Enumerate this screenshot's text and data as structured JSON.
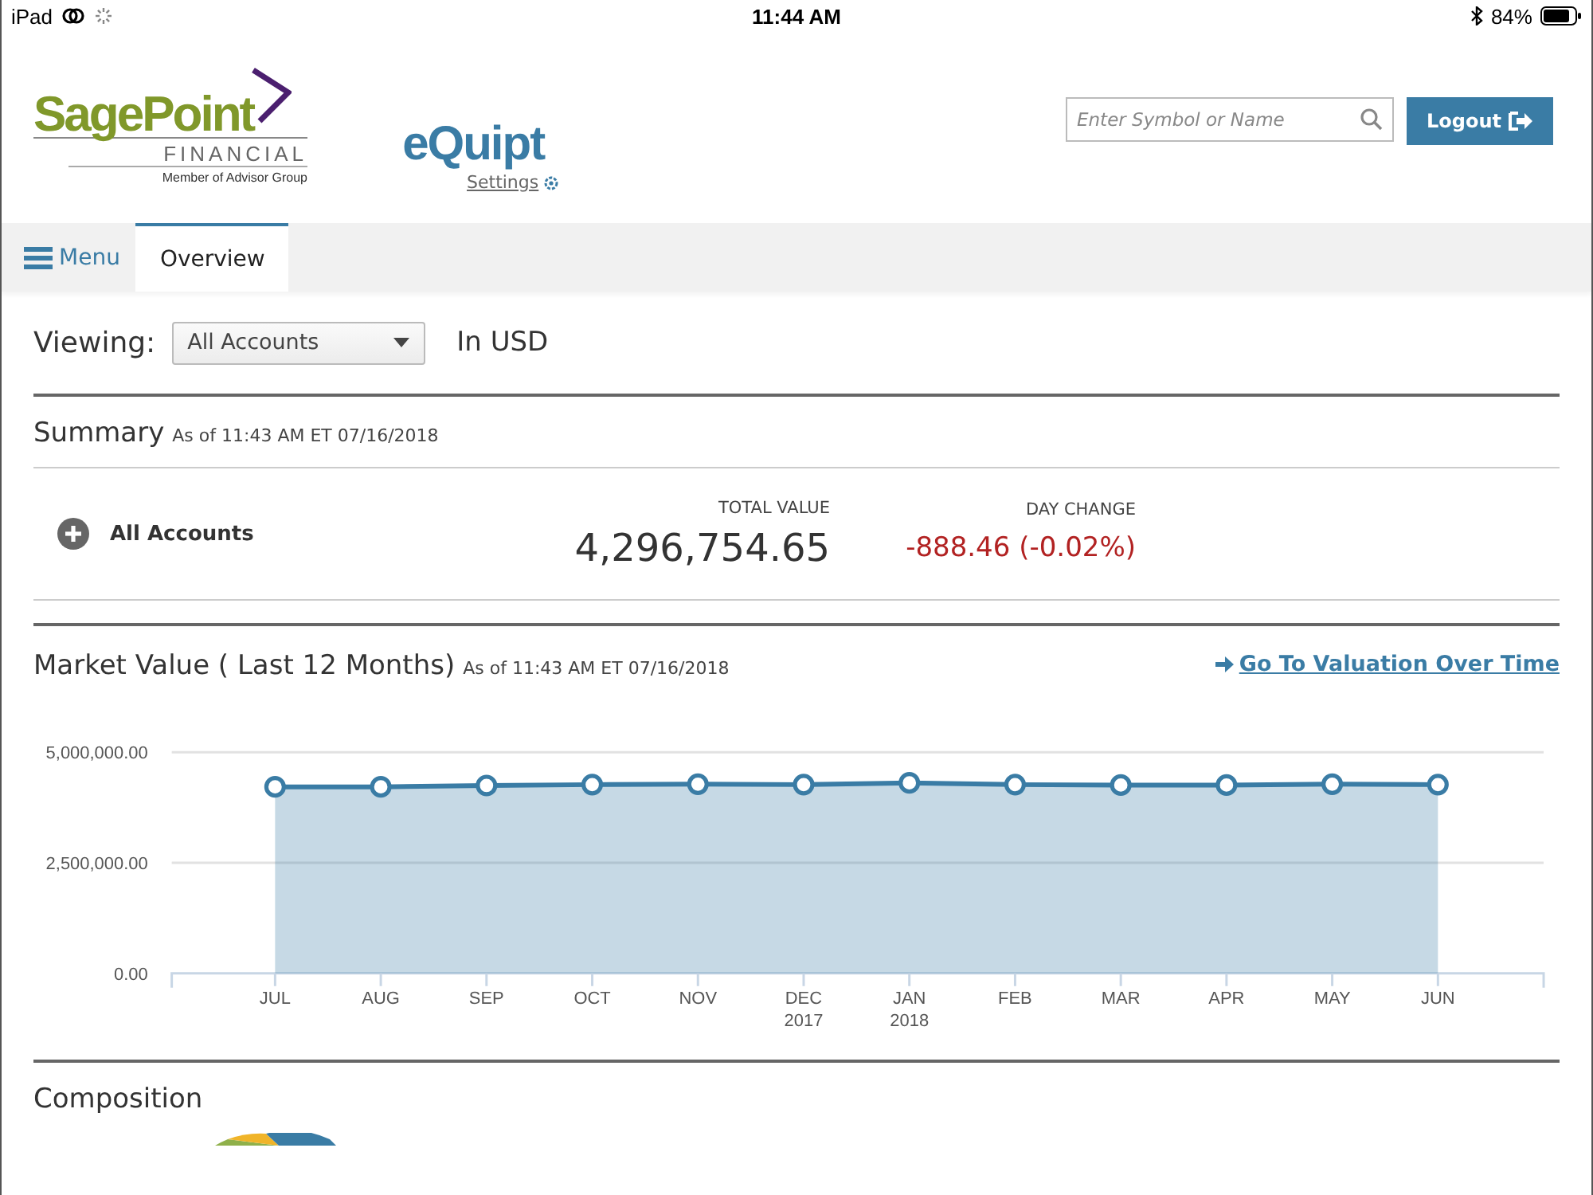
{
  "status_bar": {
    "device": "iPad",
    "time": "11:44 AM",
    "battery": "84%"
  },
  "header": {
    "logo": {
      "name": "SagePoint",
      "line_2": "FINANCIAL",
      "line_3": "Member of Advisor Group"
    },
    "app": {
      "title": "eQuipt",
      "settings_link": "Settings"
    },
    "search": {
      "placeholder": "Enter Symbol or Name"
    },
    "logout_button": "Logout"
  },
  "nav": {
    "menu": "Menu",
    "tabs": [
      {
        "label": "Overview",
        "selected": true
      }
    ]
  },
  "viewing": {
    "label": "Viewing:",
    "select": "All Accounts",
    "currency": "In USD"
  },
  "summary": {
    "title": "Summary",
    "as_of": "As of 11:43 AM ET 07/16/2018",
    "accounts": [
      {
        "name": "All Accounts",
        "expanded": false,
        "total_value_label": "TOTAL VALUE",
        "total_value": "4,296,754.65",
        "day_change_label": "DAY CHANGE",
        "day_change": "-888.46 (-0.02%)"
      }
    ]
  },
  "market_value": {
    "title": "Market Value ( Last 12 Months)",
    "as_of": "As of 11:43 AM ET 07/16/2018",
    "link": "Go To Valuation Over Time",
    "chart_data": {
      "type": "area",
      "categories": [
        "JUL",
        "AUG",
        "SEP",
        "OCT",
        "NOV",
        "DEC\n2017",
        "JAN\n2018",
        "FEB",
        "MAR",
        "APR",
        "MAY",
        "JUN"
      ],
      "series": [
        {
          "color": "#3a7ca5",
          "values": [
            4220000,
            4220000,
            4250000,
            4270000,
            4280000,
            4270000,
            4310000,
            4270000,
            4260000,
            4260000,
            4280000,
            4270000
          ]
        }
      ],
      "ylim": [
        0,
        5000000
      ],
      "yticks": [
        {
          "value": 0,
          "label": "0.00"
        },
        {
          "value": 2500000,
          "label": "2,500,000.00"
        },
        {
          "value": 5000000,
          "label": "5,000,000.00"
        }
      ]
    }
  },
  "composition": {
    "title": "Composition"
  }
}
